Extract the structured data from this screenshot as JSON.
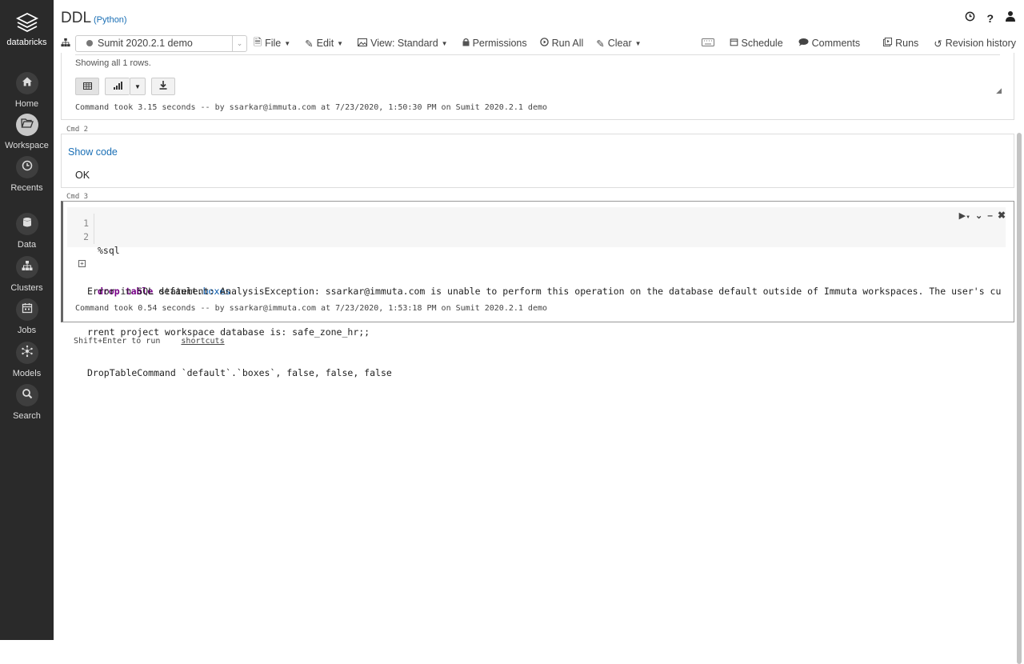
{
  "sidebar": {
    "logo_text": "databricks",
    "items": [
      {
        "label": "Home",
        "icon": "home-icon"
      },
      {
        "label": "Workspace",
        "icon": "folder-icon"
      },
      {
        "label": "Recents",
        "icon": "clock-icon"
      },
      {
        "label": "Data",
        "icon": "database-icon"
      },
      {
        "label": "Clusters",
        "icon": "cluster-icon"
      },
      {
        "label": "Jobs",
        "icon": "calendar-icon"
      },
      {
        "label": "Models",
        "icon": "models-icon"
      },
      {
        "label": "Search",
        "icon": "search-icon"
      }
    ]
  },
  "header": {
    "notebook_title": "DDL",
    "language": "(Python)"
  },
  "toolbar": {
    "cluster_name": "Sumit 2020.2.1 demo",
    "file": "File",
    "edit": "Edit",
    "view": "View: Standard",
    "permissions": "Permissions",
    "run_all": "Run All",
    "clear": "Clear",
    "schedule": "Schedule",
    "comments": "Comments",
    "runs": "Runs",
    "revision_history": "Revision history"
  },
  "cell1": {
    "rows_text": "Showing all 1 rows.",
    "command_took": "Command took 3.15 seconds -- by ssarkar@immuta.com at 7/23/2020, 1:50:30 PM on Sumit 2020.2.1 demo"
  },
  "cell2": {
    "cmd_label": "Cmd 2",
    "show_code": "Show code",
    "output": "OK"
  },
  "cell3": {
    "cmd_label": "Cmd 3",
    "line1_no": "1",
    "line1": "%sql",
    "line2_no": "2",
    "kw_drop": "drop",
    "kw_table": "table",
    "ident_prefix": "default.",
    "ident_name": "boxes",
    "error_line1": "Error in SQL statement: AnalysisException: ssarkar@immuta.com is unable to perform this operation on the database default outside of Immuta workspaces. The user's cu",
    "error_line2": "rrent project workspace database is: safe_zone_hr;;",
    "error_line3": "DropTableCommand `default`.`boxes`, false, false, false",
    "command_took": "Command took 0.54 seconds -- by ssarkar@immuta.com at 7/23/2020, 1:53:18 PM on Sumit 2020.2.1 demo"
  },
  "footer": {
    "hint": "Shift+Enter to run",
    "shortcuts": "shortcuts"
  },
  "colors": {
    "sidebar_bg": "#2a2a2a",
    "link": "#1a6fb5",
    "keyword": "#770088",
    "identifier": "#0055aa"
  }
}
